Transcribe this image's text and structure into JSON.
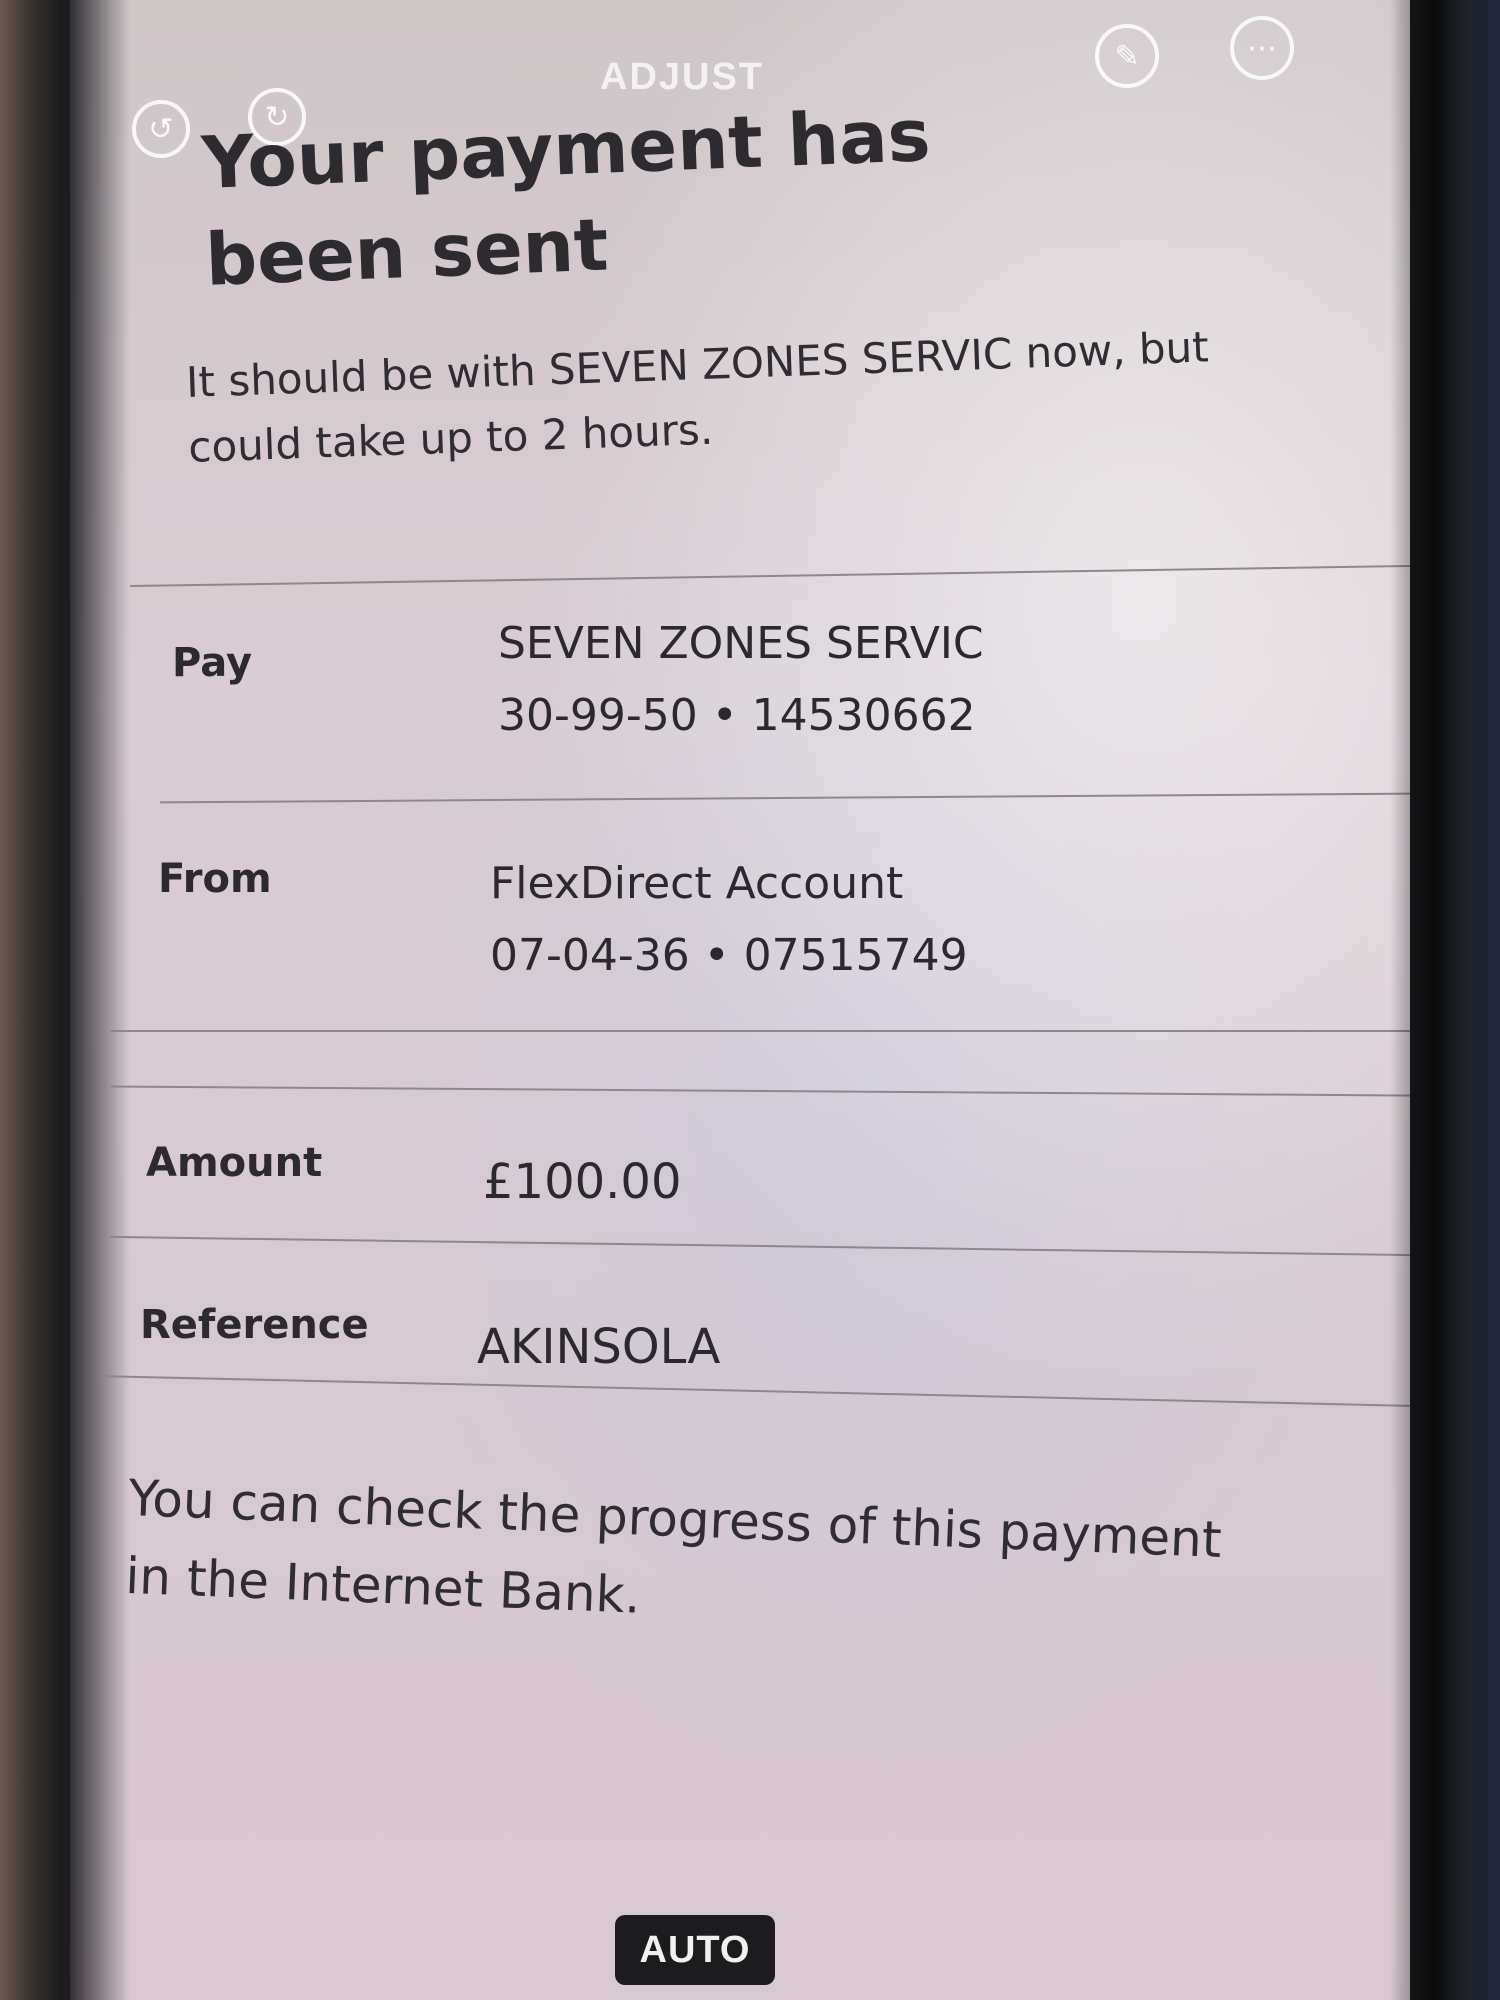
{
  "camera_overlay": {
    "adjust_label": "ADJUST",
    "auto_label": "AUTO",
    "icons": [
      "undo-icon",
      "redo-icon",
      "markup-icon",
      "more-icon"
    ]
  },
  "confirmation": {
    "title": "Your payment has been sent",
    "subtitle": "It should be with SEVEN ZONES SERVIC now, but could take up to 2 hours.",
    "rows": [
      {
        "label": "Pay",
        "line1": "SEVEN ZONES SERVIC",
        "line2": "30-99-50 • 14530662"
      },
      {
        "label": "From",
        "line1": "FlexDirect Account",
        "line2": "07-04-36 • 07515749"
      },
      {
        "label": "Amount",
        "line1": "£100.00",
        "line2": ""
      },
      {
        "label": "Reference",
        "line1": "AKINSOLA",
        "line2": ""
      }
    ],
    "footer": "You can check the progress of this payment in the Internet Bank."
  }
}
